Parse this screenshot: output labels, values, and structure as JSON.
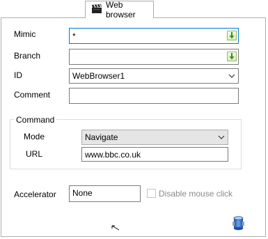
{
  "tab": {
    "label": "Web browser",
    "icon": "clapperboard-icon"
  },
  "form": {
    "mimic": {
      "label": "Mimic",
      "value": "*"
    },
    "branch": {
      "label": "Branch",
      "value": ""
    },
    "id": {
      "label": "ID",
      "value": "WebBrowser1"
    },
    "comment": {
      "label": "Comment",
      "value": ""
    }
  },
  "command": {
    "title": "Command",
    "mode": {
      "label": "Mode",
      "value": "Navigate"
    },
    "url": {
      "label": "URL",
      "value": "www.bbc.co.uk"
    }
  },
  "accelerator": {
    "label": "Accelerator",
    "value": "None"
  },
  "disable_mouse_click": {
    "label": "Disable mouse click",
    "checked": false
  },
  "colors": {
    "focus_border": "#0078d7",
    "pick_button": "#3f8f1f",
    "disabled_text": "#8a8a8a"
  }
}
